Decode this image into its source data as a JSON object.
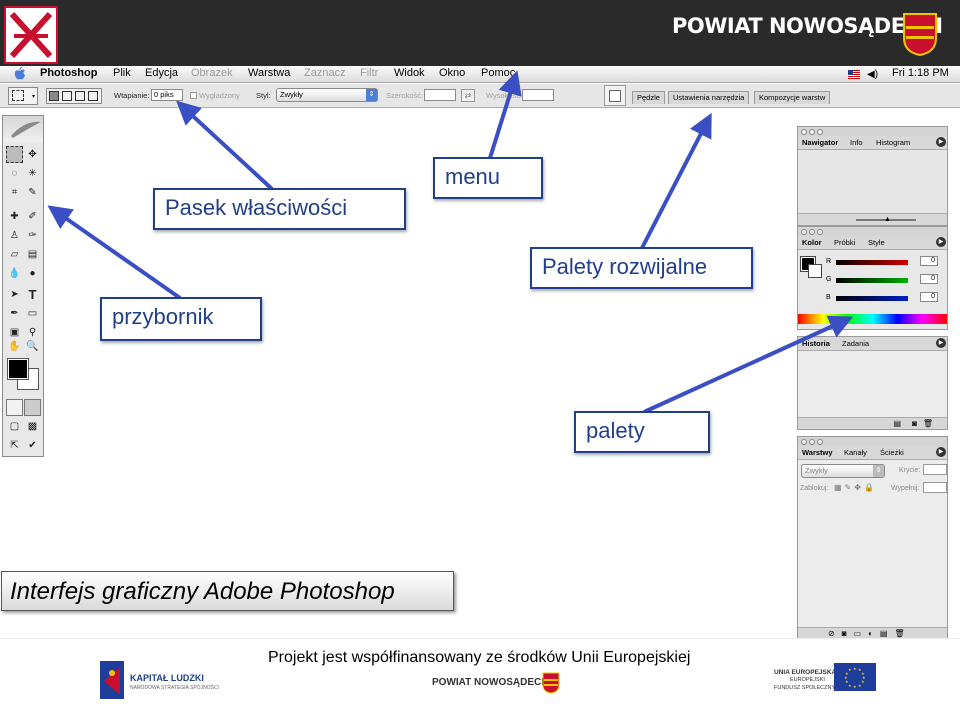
{
  "banner": {
    "title": "POWIAT NOWOSĄDECKI"
  },
  "menubar": {
    "items": [
      {
        "label": "Photoshop",
        "state": "bold"
      },
      {
        "label": "Plik",
        "state": "normal"
      },
      {
        "label": "Edycja",
        "state": "normal"
      },
      {
        "label": "Obrazek",
        "state": "disabled"
      },
      {
        "label": "Warstwa",
        "state": "normal"
      },
      {
        "label": "Zaznacz",
        "state": "disabled"
      },
      {
        "label": "Filtr",
        "state": "disabled"
      },
      {
        "label": "Widok",
        "state": "normal"
      },
      {
        "label": "Okno",
        "state": "normal"
      },
      {
        "label": "Pomoc",
        "state": "normal"
      }
    ],
    "clock": "Fri 1:18 PM"
  },
  "options_bar": {
    "feather_label": "Wtapianie:",
    "feather_value": "0 piks",
    "antialias_label": "Wygładzony",
    "style_label": "Styl:",
    "style_value": "Zwykły",
    "width_label": "Szerokość:",
    "height_label": "Wysokość:",
    "palette_tabs": [
      "Pędzle",
      "Ustawienia narzędzia",
      "Kompozycje warstw"
    ]
  },
  "palettes": {
    "navigator_tabs": [
      "Nawigator",
      "Info",
      "Histogram"
    ],
    "color_tabs": [
      "Kolor",
      "Próbki",
      "Style"
    ],
    "color_channels": [
      {
        "label": "R",
        "value": "0",
        "color": "#d40000"
      },
      {
        "label": "G",
        "value": "0",
        "color": "#00b000"
      },
      {
        "label": "B",
        "value": "0",
        "color": "#0020c8"
      }
    ],
    "history_tabs": [
      "Historia",
      "Zadania"
    ],
    "layers_tabs": [
      "Warstwy",
      "Kanały",
      "Ścieżki"
    ],
    "layers_blend": "Zwykły",
    "layers_opacity_label": "Krycie:",
    "layers_lock_label": "Zablokuj:",
    "layers_fill_label": "Wypełnij:"
  },
  "callouts": {
    "options_bar": "Pasek właściwości",
    "menu": "menu",
    "dropdown_palettes": "Palety rozwijalne",
    "toolbox": "przybornik",
    "palettes": "palety"
  },
  "caption": "Interfejs graficzny Adobe Photoshop",
  "footer": {
    "cofunding": "Projekt jest  współfinansowany ze środków Unii Europejskiej",
    "kl_title": "KAPITAŁ LUDZKI",
    "kl_sub": "NARODOWA STRATEGIA SPÓJNOŚCI",
    "powiat": "POWIAT NOWOSĄDECKI",
    "ue_line1": "UNIA EUROPEJSKA",
    "ue_line2": "EUROPEJSKI",
    "ue_line3": "FUNDUSZ SPOŁECZNY"
  },
  "colors": {
    "callout_blue": "#1f3e8c",
    "arrow_blue": "#3a4fc4",
    "brand_red": "#c8102e"
  }
}
